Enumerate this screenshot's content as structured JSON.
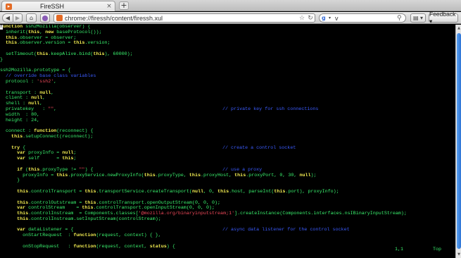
{
  "tab": {
    "title": "FireSSH",
    "favicon": "firessh-icon",
    "close_glyph": "×"
  },
  "new_tab_glyph": "+",
  "nav": {
    "back_glyph": "◀",
    "forward_glyph": "▶",
    "home_glyph": "⌂",
    "url": "chrome://firessh/content/firessh.xul",
    "star_glyph": "☆",
    "reload_glyph": "↻",
    "search_engine_glyph": "g",
    "search_drop": "▾",
    "search_value": "v",
    "search_glyph": "⚲",
    "menu_glyph": "▤ ▾",
    "feedback_label": "Feedback ▾"
  },
  "colors": {
    "keyword": "#f5ef52",
    "comment": "#3b5cff",
    "string": "#f0495a",
    "default": "#3af26e",
    "scroll_accent": "#2e74d6"
  },
  "terminal": {
    "lines": [
      [
        {
          "t": "f",
          "c": "cur"
        },
        {
          "t": "unction",
          "c": "kw"
        },
        {
          "t": " ssh2Mozilla(observer) {",
          "c": "df"
        }
      ],
      [
        {
          "t": "  inherit(",
          "c": "df"
        },
        {
          "t": "this",
          "c": "kw"
        },
        {
          "t": ", ",
          "c": "df"
        },
        {
          "t": "new",
          "c": "kw"
        },
        {
          "t": " baseProtocol());",
          "c": "df"
        }
      ],
      [
        {
          "t": "  this",
          "c": "kw"
        },
        {
          "t": ".observer = observer;",
          "c": "df"
        }
      ],
      [
        {
          "t": "  this",
          "c": "kw"
        },
        {
          "t": ".observer.version = ",
          "c": "df"
        },
        {
          "t": "this",
          "c": "kw"
        },
        {
          "t": ".version;",
          "c": "df"
        }
      ],
      [],
      [
        {
          "t": "  setTimeout(",
          "c": "df"
        },
        {
          "t": "this",
          "c": "kw"
        },
        {
          "t": ".keepAlive.bind(",
          "c": "df"
        },
        {
          "t": "this",
          "c": "kw"
        },
        {
          "t": "), 60000);",
          "c": "df"
        }
      ],
      [
        {
          "t": "}",
          "c": "df"
        }
      ],
      [],
      [
        {
          "t": "ssh2Mozilla.prototype = {",
          "c": "df"
        }
      ],
      [
        {
          "t": "  // override base class variables",
          "c": "cm"
        }
      ],
      [
        {
          "t": "  protocol : ",
          "c": "df"
        },
        {
          "t": "'ssh2'",
          "c": "str"
        },
        {
          "t": ",",
          "c": "df"
        }
      ],
      [],
      [
        {
          "t": "  transport : ",
          "c": "df"
        },
        {
          "t": "null",
          "c": "kw"
        },
        {
          "t": ",",
          "c": "df"
        }
      ],
      [
        {
          "t": "  client : ",
          "c": "df"
        },
        {
          "t": "null",
          "c": "kw"
        },
        {
          "t": ",",
          "c": "df"
        }
      ],
      [
        {
          "t": "  shell : ",
          "c": "df"
        },
        {
          "t": "null",
          "c": "kw"
        },
        {
          "t": ",",
          "c": "df"
        }
      ],
      [
        {
          "t": "  privatekey   : ",
          "c": "df"
        },
        {
          "t": "\"\"",
          "c": "str"
        },
        {
          "t": ",",
          "c": "df"
        },
        {
          "t": "// private key for ssh connections",
          "c": "cmr"
        }
      ],
      [
        {
          "t": "  width  : 80,",
          "c": "df"
        }
      ],
      [
        {
          "t": "  height : 24,",
          "c": "df"
        }
      ],
      [],
      [
        {
          "t": "  connect : ",
          "c": "df"
        },
        {
          "t": "function",
          "c": "kw"
        },
        {
          "t": "(reconnect) {",
          "c": "df"
        }
      ],
      [
        {
          "t": "    this",
          "c": "kw"
        },
        {
          "t": ".setupConnect(reconnect);",
          "c": "df"
        }
      ],
      [],
      [
        {
          "t": "    ",
          "c": "df"
        },
        {
          "t": "try",
          "c": "kw"
        },
        {
          "t": " {",
          "c": "df"
        },
        {
          "t": "// create a control socket",
          "c": "cmr"
        }
      ],
      [
        {
          "t": "      ",
          "c": "df"
        },
        {
          "t": "var",
          "c": "kw"
        },
        {
          "t": " proxyInfo = ",
          "c": "df"
        },
        {
          "t": "null",
          "c": "kw"
        },
        {
          "t": ";",
          "c": "df"
        }
      ],
      [
        {
          "t": "      ",
          "c": "df"
        },
        {
          "t": "var",
          "c": "kw"
        },
        {
          "t": " self      = ",
          "c": "df"
        },
        {
          "t": "this",
          "c": "kw"
        },
        {
          "t": ";",
          "c": "df"
        }
      ],
      [],
      [
        {
          "t": "      ",
          "c": "df"
        },
        {
          "t": "if",
          "c": "kw"
        },
        {
          "t": " (",
          "c": "df"
        },
        {
          "t": "this",
          "c": "kw"
        },
        {
          "t": ".proxyType != ",
          "c": "df"
        },
        {
          "t": "\"\"",
          "c": "str"
        },
        {
          "t": ") {",
          "c": "df"
        },
        {
          "t": "// use a proxy",
          "c": "cmr"
        }
      ],
      [
        {
          "t": "        proxyInfo = ",
          "c": "df"
        },
        {
          "t": "this",
          "c": "kw"
        },
        {
          "t": ".proxyService.newProxyInfo(",
          "c": "df"
        },
        {
          "t": "this",
          "c": "kw"
        },
        {
          "t": ".proxyType, ",
          "c": "df"
        },
        {
          "t": "this",
          "c": "kw"
        },
        {
          "t": ".proxyHost, ",
          "c": "df"
        },
        {
          "t": "this",
          "c": "kw"
        },
        {
          "t": ".proxyPort, 0, 30, ",
          "c": "df"
        },
        {
          "t": "null",
          "c": "kw"
        },
        {
          "t": ");",
          "c": "df"
        }
      ],
      [
        {
          "t": "      }",
          "c": "df"
        }
      ],
      [],
      [
        {
          "t": "      ",
          "c": "df"
        },
        {
          "t": "this",
          "c": "kw"
        },
        {
          "t": ".controlTransport = ",
          "c": "df"
        },
        {
          "t": "this",
          "c": "kw"
        },
        {
          "t": ".transportService.createTransport(",
          "c": "df"
        },
        {
          "t": "null",
          "c": "kw"
        },
        {
          "t": ", 0, ",
          "c": "df"
        },
        {
          "t": "this",
          "c": "kw"
        },
        {
          "t": ".host, parseInt(",
          "c": "df"
        },
        {
          "t": "this",
          "c": "kw"
        },
        {
          "t": ".port), proxyInfo);",
          "c": "df"
        }
      ],
      [],
      [
        {
          "t": "      ",
          "c": "df"
        },
        {
          "t": "this",
          "c": "kw"
        },
        {
          "t": ".controlOutstream = ",
          "c": "df"
        },
        {
          "t": "this",
          "c": "kw"
        },
        {
          "t": ".controlTransport.openOutputStream(0, 0, 0);",
          "c": "df"
        }
      ],
      [
        {
          "t": "      ",
          "c": "df"
        },
        {
          "t": "var",
          "c": "kw"
        },
        {
          "t": " controlStream    = ",
          "c": "df"
        },
        {
          "t": "this",
          "c": "kw"
        },
        {
          "t": ".controlTransport.openInputStream(0, 0, 0);",
          "c": "df"
        }
      ],
      [
        {
          "t": "      ",
          "c": "df"
        },
        {
          "t": "this",
          "c": "kw"
        },
        {
          "t": ".controlInstream  = Components.classes[",
          "c": "df"
        },
        {
          "t": "'@mozilla.org/binaryinputstream;1'",
          "c": "str"
        },
        {
          "t": "].createInstance(Components.interfaces.nsIBinaryInputStream);",
          "c": "df"
        }
      ],
      [
        {
          "t": "      ",
          "c": "df"
        },
        {
          "t": "this",
          "c": "kw"
        },
        {
          "t": ".controlInstream.setInputStream(controlStream);",
          "c": "df"
        }
      ],
      [],
      [
        {
          "t": "      ",
          "c": "df"
        },
        {
          "t": "var",
          "c": "kw"
        },
        {
          "t": " dataListener = {",
          "c": "df"
        },
        {
          "t": "// async data listener for the control socket",
          "c": "cmr"
        }
      ],
      [
        {
          "t": "        onStartRequest  : ",
          "c": "df"
        },
        {
          "t": "function",
          "c": "kw"
        },
        {
          "t": "(request, context) { },",
          "c": "df"
        }
      ],
      [],
      [
        {
          "t": "        onStopRequest   : ",
          "c": "df"
        },
        {
          "t": "function",
          "c": "kw"
        },
        {
          "t": "(request, context, ",
          "c": "df"
        },
        {
          "t": "status",
          "c": "kw"
        },
        {
          "t": ") {",
          "c": "df"
        }
      ]
    ],
    "status_position": "1,1",
    "status_scroll": "Top"
  },
  "scrollbar": {
    "up_glyph": "▲",
    "down_glyph": "▼",
    "position_fraction": 0.0
  }
}
